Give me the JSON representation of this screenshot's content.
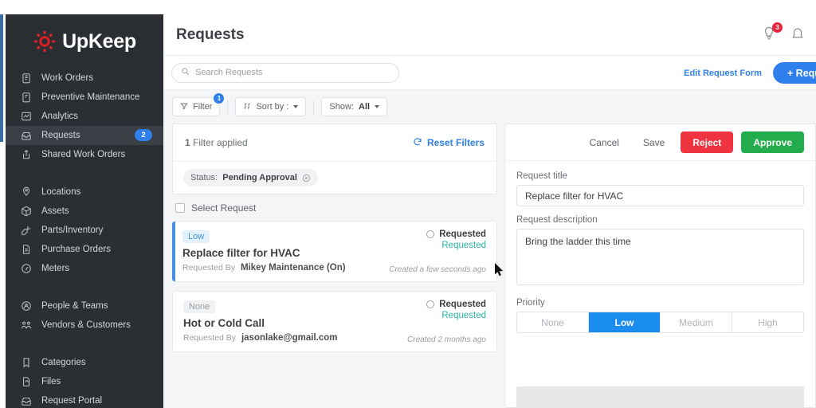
{
  "brand": {
    "name": "UpKeep",
    "logo_icon": "gear-icon",
    "accent": "#ed1c24"
  },
  "sidebar": {
    "groups": [
      {
        "items": [
          {
            "label": "Work Orders",
            "icon": "clipboard-icon",
            "active": false
          },
          {
            "label": "Preventive Maintenance",
            "icon": "checklist-icon",
            "active": false
          },
          {
            "label": "Analytics",
            "icon": "chart-icon",
            "active": false
          },
          {
            "label": "Requests",
            "icon": "inbox-icon",
            "active": true,
            "badge": "2"
          },
          {
            "label": "Shared Work Orders",
            "icon": "share-icon",
            "active": false
          }
        ]
      },
      {
        "items": [
          {
            "label": "Locations",
            "icon": "pin-icon",
            "active": false
          },
          {
            "label": "Assets",
            "icon": "cube-icon",
            "active": false
          },
          {
            "label": "Parts/Inventory",
            "icon": "wrench-icon",
            "active": false
          },
          {
            "label": "Purchase Orders",
            "icon": "document-icon",
            "active": false
          },
          {
            "label": "Meters",
            "icon": "gauge-icon",
            "active": false
          }
        ]
      },
      {
        "items": [
          {
            "label": "People & Teams",
            "icon": "people-icon",
            "active": false
          },
          {
            "label": "Vendors & Customers",
            "icon": "vendors-icon",
            "active": false
          }
        ]
      },
      {
        "items": [
          {
            "label": "Categories",
            "icon": "bookmark-icon",
            "active": false
          },
          {
            "label": "Files",
            "icon": "file-icon",
            "active": false
          },
          {
            "label": "Request Portal",
            "icon": "portal-icon",
            "active": false
          }
        ]
      }
    ]
  },
  "header": {
    "title": "Requests",
    "tips_icon": "lightbulb-icon",
    "tips_badge": "3",
    "notifications_icon": "bell-icon"
  },
  "search": {
    "placeholder": "Search Requests",
    "value": "",
    "icon": "search-icon"
  },
  "header_actions": {
    "edit_form_label": "Edit Request Form",
    "new_request_label": "+ Request"
  },
  "toolbar": {
    "filter_label": "Filter",
    "filter_badge": "1",
    "filter_icon": "funnel-icon",
    "sort_label": "Sort by :",
    "sort_icon": "sort-icon",
    "show_label": "Show:",
    "show_value": "All"
  },
  "filter_panel": {
    "applied_count": "1",
    "applied_text": "Filter applied",
    "reset_label": "Reset Filters",
    "reset_icon": "refresh-icon",
    "chips": [
      {
        "key": "Status:",
        "value": "Pending Approval",
        "remove_icon": "close-circle-icon"
      }
    ]
  },
  "list": {
    "select_all_label": "Select Request",
    "requests": [
      {
        "priority": "Low",
        "priority_style": "low",
        "title": "Replace filter for HVAC",
        "requested_by_label": "Requested By",
        "requested_by": "Mikey Maintenance (On)",
        "created": "Created a few seconds ago",
        "status": "Requested",
        "status_sub": "Requested",
        "selected": true
      },
      {
        "priority": "None",
        "priority_style": "none",
        "title": "Hot or Cold Call",
        "requested_by_label": "Requested By",
        "requested_by": "jasonlake@gmail.com",
        "created": "Created 2 months ago",
        "status": "Requested",
        "status_sub": "Requested",
        "selected": false
      }
    ]
  },
  "detail": {
    "cancel_label": "Cancel",
    "save_label": "Save",
    "reject_label": "Reject",
    "approve_label": "Approve",
    "title_label": "Request title",
    "title_value": "Replace filter for HVAC",
    "description_label": "Request description",
    "description_value": "Bring the ladder this time",
    "priority_label": "Priority",
    "priority_options": [
      "None",
      "Low",
      "Medium",
      "High"
    ],
    "priority_selected": "Low"
  },
  "colors": {
    "blue": "#2f80ed",
    "green": "#22ac4b",
    "red": "#ef3340",
    "teal": "#2ab5a8",
    "sidebar": "#2b2f33"
  }
}
